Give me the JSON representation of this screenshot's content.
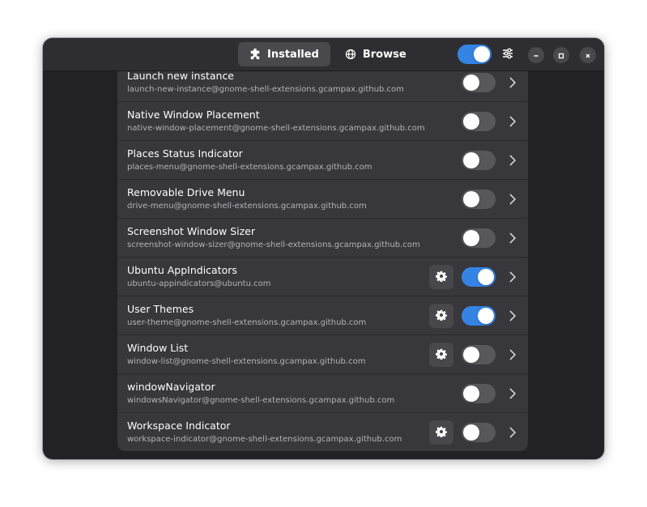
{
  "header": {
    "tabs": [
      {
        "label": "Installed",
        "icon": "puzzle-icon",
        "active": true
      },
      {
        "label": "Browse",
        "icon": "globe-icon",
        "active": false
      }
    ],
    "extensions_enabled": true,
    "menu_icon": "sliders-icon",
    "window_controls": [
      "minimize-icon",
      "maximize-icon",
      "close-icon"
    ]
  },
  "colors": {
    "accent": "#3584e4",
    "window_bg": "#222226",
    "header_bg": "#2e2e32",
    "row_bg": "#37373c"
  },
  "extensions": [
    {
      "name": "Launch new instance",
      "uuid": "launch-new-instance@gnome-shell-extensions.gcampax.github.com",
      "has_settings": false,
      "enabled": false
    },
    {
      "name": "Native Window Placement",
      "uuid": "native-window-placement@gnome-shell-extensions.gcampax.github.com",
      "has_settings": false,
      "enabled": false
    },
    {
      "name": "Places Status Indicator",
      "uuid": "places-menu@gnome-shell-extensions.gcampax.github.com",
      "has_settings": false,
      "enabled": false
    },
    {
      "name": "Removable Drive Menu",
      "uuid": "drive-menu@gnome-shell-extensions.gcampax.github.com",
      "has_settings": false,
      "enabled": false
    },
    {
      "name": "Screenshot Window Sizer",
      "uuid": "screenshot-window-sizer@gnome-shell-extensions.gcampax.github.com",
      "has_settings": false,
      "enabled": false
    },
    {
      "name": "Ubuntu AppIndicators",
      "uuid": "ubuntu-appindicators@ubuntu.com",
      "has_settings": true,
      "enabled": true
    },
    {
      "name": "User Themes",
      "uuid": "user-theme@gnome-shell-extensions.gcampax.github.com",
      "has_settings": true,
      "enabled": true
    },
    {
      "name": "Window List",
      "uuid": "window-list@gnome-shell-extensions.gcampax.github.com",
      "has_settings": true,
      "enabled": false
    },
    {
      "name": "windowNavigator",
      "uuid": "windowsNavigator@gnome-shell-extensions.gcampax.github.com",
      "has_settings": false,
      "enabled": false
    },
    {
      "name": "Workspace Indicator",
      "uuid": "workspace-indicator@gnome-shell-extensions.gcampax.github.com",
      "has_settings": true,
      "enabled": false
    }
  ]
}
